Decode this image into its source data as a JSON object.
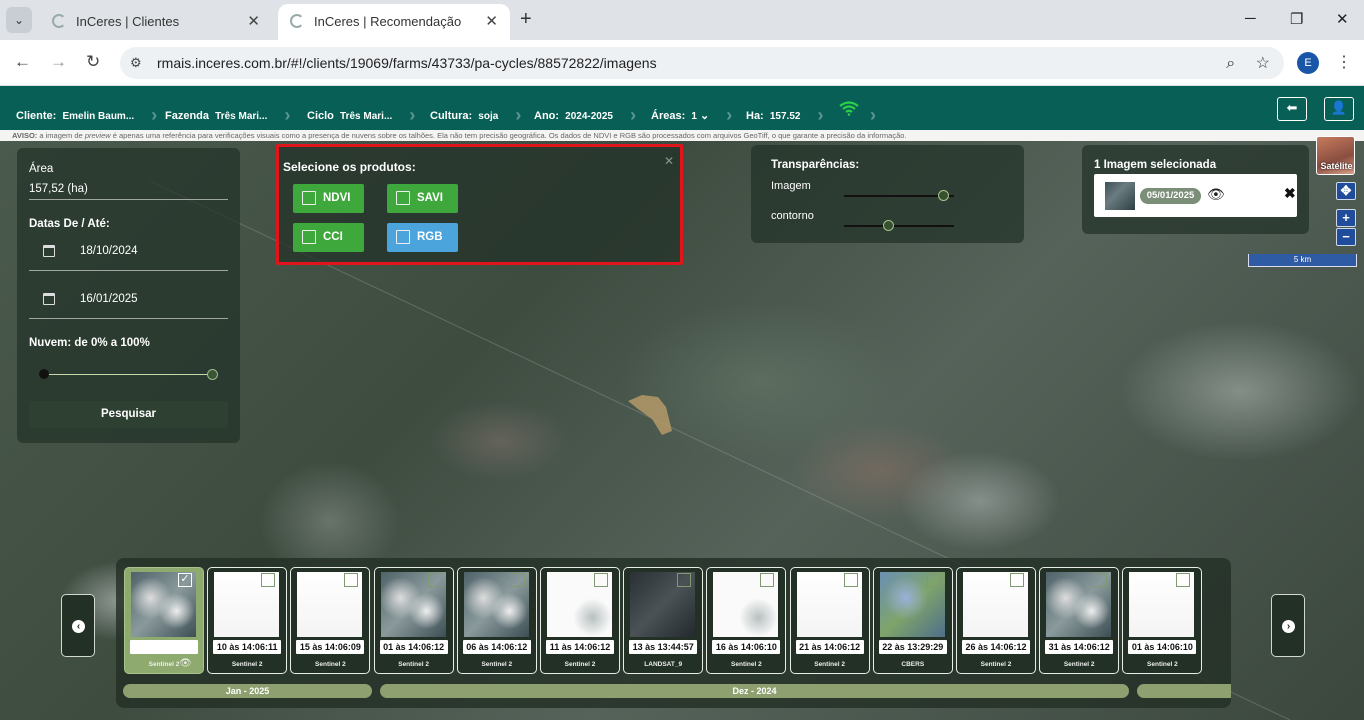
{
  "browser": {
    "tabs": [
      {
        "title": "InCeres | Clientes"
      },
      {
        "title": "InCeres | Recomendação"
      }
    ],
    "url": "rmais.inceres.com.br/#!/clients/19069/farms/43733/pa-cycles/88572822/imagens",
    "profile_initial": "E"
  },
  "header": {
    "cliente_label": "Cliente:",
    "cliente_value": "Emelin Baum...",
    "fazenda_label": "Fazenda",
    "fazenda_value": "Três Mari...",
    "ciclo_label": "Ciclo",
    "ciclo_value": "Três Mari...",
    "cultura_label": "Cultura:",
    "cultura_value": "soja",
    "ano_label": "Ano:",
    "ano_value": "2024-2025",
    "areas_label": "Áreas:",
    "areas_value": "1",
    "ha_label": "Ha:",
    "ha_value": "157.52"
  },
  "warning": {
    "prefix": "AVISO:",
    "text_a": " a imagem de ",
    "preview": "preview",
    "text_b": " é apenas uma referência para verificações visuais como a presença de nuvens sobre os talhões. Ela não tem precisão geográfica. Os dados de NDVI e RGB são processados com arquivos GeoTiff, o que garante a precisão da informação."
  },
  "left_panel": {
    "area_label": "Área",
    "area_value": "157,52 (ha)",
    "dates_label": "Datas De / Até:",
    "date_from": "18/10/2024",
    "date_to": "16/01/2025",
    "cloud_label": "Nuvem: de 0% a 100%",
    "search_button": "Pesquisar"
  },
  "products": {
    "title": "Selecione os produtos:",
    "close": "✕",
    "items": [
      {
        "label": "NDVI",
        "color": "#3fa83d"
      },
      {
        "label": "SAVI",
        "color": "#3fa83d"
      },
      {
        "label": "CCI",
        "color": "#3fa83d"
      },
      {
        "label": "RGB",
        "color": "#4ba4dc"
      }
    ]
  },
  "transparency": {
    "title": "Transparências:",
    "image_label": "Imagem",
    "image_level": 0.9,
    "contour_label": "contorno",
    "contour_level": 0.4
  },
  "selected": {
    "title": "1 Imagem selecionada",
    "date": "05/01/2025"
  },
  "map": {
    "satellite_label": "Satélite",
    "zoom_in": "+",
    "zoom_out": "−",
    "scale": "5 km"
  },
  "timeline": {
    "items": [
      {
        "time": "",
        "sat": "Sentinel 2",
        "type": "cloudy",
        "checked": true
      },
      {
        "time": "10 às 14:06:11",
        "sat": "Sentinel 2",
        "type": "white",
        "checked": false
      },
      {
        "time": "15 às 14:06:09",
        "sat": "Sentinel 2",
        "type": "white",
        "checked": false
      },
      {
        "time": "01 às 14:06:12",
        "sat": "Sentinel 2",
        "type": "cloudy",
        "checked": false
      },
      {
        "time": "06 às 14:06:12",
        "sat": "Sentinel 2",
        "type": "cloudy",
        "checked": false
      },
      {
        "time": "11 às 14:06:12",
        "sat": "Sentinel 2",
        "type": "light",
        "checked": false
      },
      {
        "time": "13 às 13:44:57",
        "sat": "LANDSAT_9",
        "type": "dark",
        "checked": false
      },
      {
        "time": "16 às 14:06:10",
        "sat": "Sentinel 2",
        "type": "light",
        "checked": false
      },
      {
        "time": "21 às 14:06:12",
        "sat": "Sentinel 2",
        "type": "white",
        "checked": false
      },
      {
        "time": "22 às 13:29:29",
        "sat": "CBERS",
        "type": "cbers",
        "checked": false
      },
      {
        "time": "26 às 14:06:12",
        "sat": "Sentinel 2",
        "type": "white",
        "checked": false
      },
      {
        "time": "31 às 14:06:12",
        "sat": "Sentinel 2",
        "type": "cloudy",
        "checked": false
      },
      {
        "time": "01 às 14:06:10",
        "sat": "Sentinel 2",
        "type": "white",
        "checked": false
      }
    ],
    "months": [
      {
        "label": "Jan - 2025"
      },
      {
        "label": "Dez - 2024"
      },
      {
        "label": ""
      }
    ]
  }
}
